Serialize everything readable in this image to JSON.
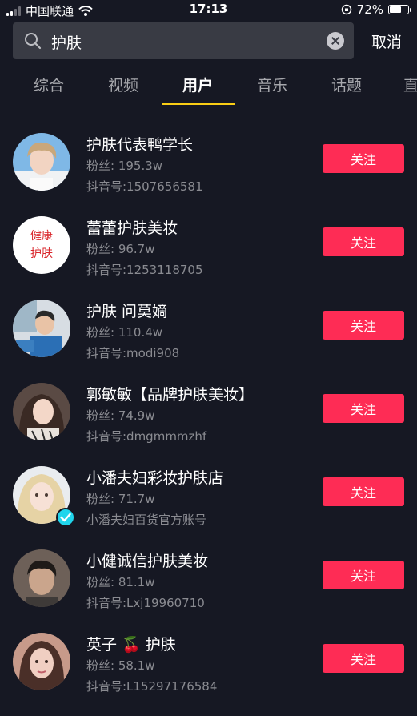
{
  "status_bar": {
    "carrier": "中国联通",
    "time": "17:13",
    "battery": "72%",
    "battery_level": 0.72,
    "icons": [
      "signal-icon",
      "wifi-icon",
      "orientation-lock-icon",
      "battery-icon"
    ]
  },
  "search": {
    "query": "护肤",
    "cancel_label": "取消"
  },
  "tabs": [
    {
      "label": "综合",
      "active": false
    },
    {
      "label": "视频",
      "active": false
    },
    {
      "label": "用户",
      "active": true
    },
    {
      "label": "音乐",
      "active": false
    },
    {
      "label": "话题",
      "active": false
    },
    {
      "label": "直",
      "active": false
    }
  ],
  "follow_label": "关注",
  "colors": {
    "background": "#161823",
    "search_bg": "#393b44",
    "accent_follow": "#fe2c55",
    "tab_indicator": "#face15",
    "verified": "#20d5ec"
  },
  "users": [
    {
      "name": "护肤代表鸭学长",
      "fans": "粉丝: 195.3w",
      "id_line": "抖音号:1507656581",
      "verified": false
    },
    {
      "name": "蕾蕾护肤美妆",
      "fans": "粉丝: 96.7w",
      "id_line": "抖音号:1253118705",
      "verified": false,
      "avatar_text": [
        "健康",
        "护肤"
      ]
    },
    {
      "name": "护肤 问莫嫡",
      "fans": "粉丝: 110.4w",
      "id_line": "抖音号:modi908",
      "verified": false
    },
    {
      "name": "郭敏敏【品牌护肤美妆】",
      "fans": "粉丝: 74.9w",
      "id_line": "抖音号:dmgmmmzhf",
      "verified": false
    },
    {
      "name": "小潘夫妇彩妆护肤店",
      "fans": "粉丝: 71.7w",
      "id_line": "小潘夫妇百货官方账号",
      "verified": true
    },
    {
      "name": "小健诚信护肤美妆",
      "fans": "粉丝: 81.1w",
      "id_line": "抖音号:Lxj19960710",
      "verified": false
    },
    {
      "name_prefix": "英子",
      "name_emoji": "🍒",
      "name_suffix": "护肤",
      "fans": "粉丝: 58.1w",
      "id_line": "抖音号:L15297176584",
      "verified": false
    }
  ]
}
